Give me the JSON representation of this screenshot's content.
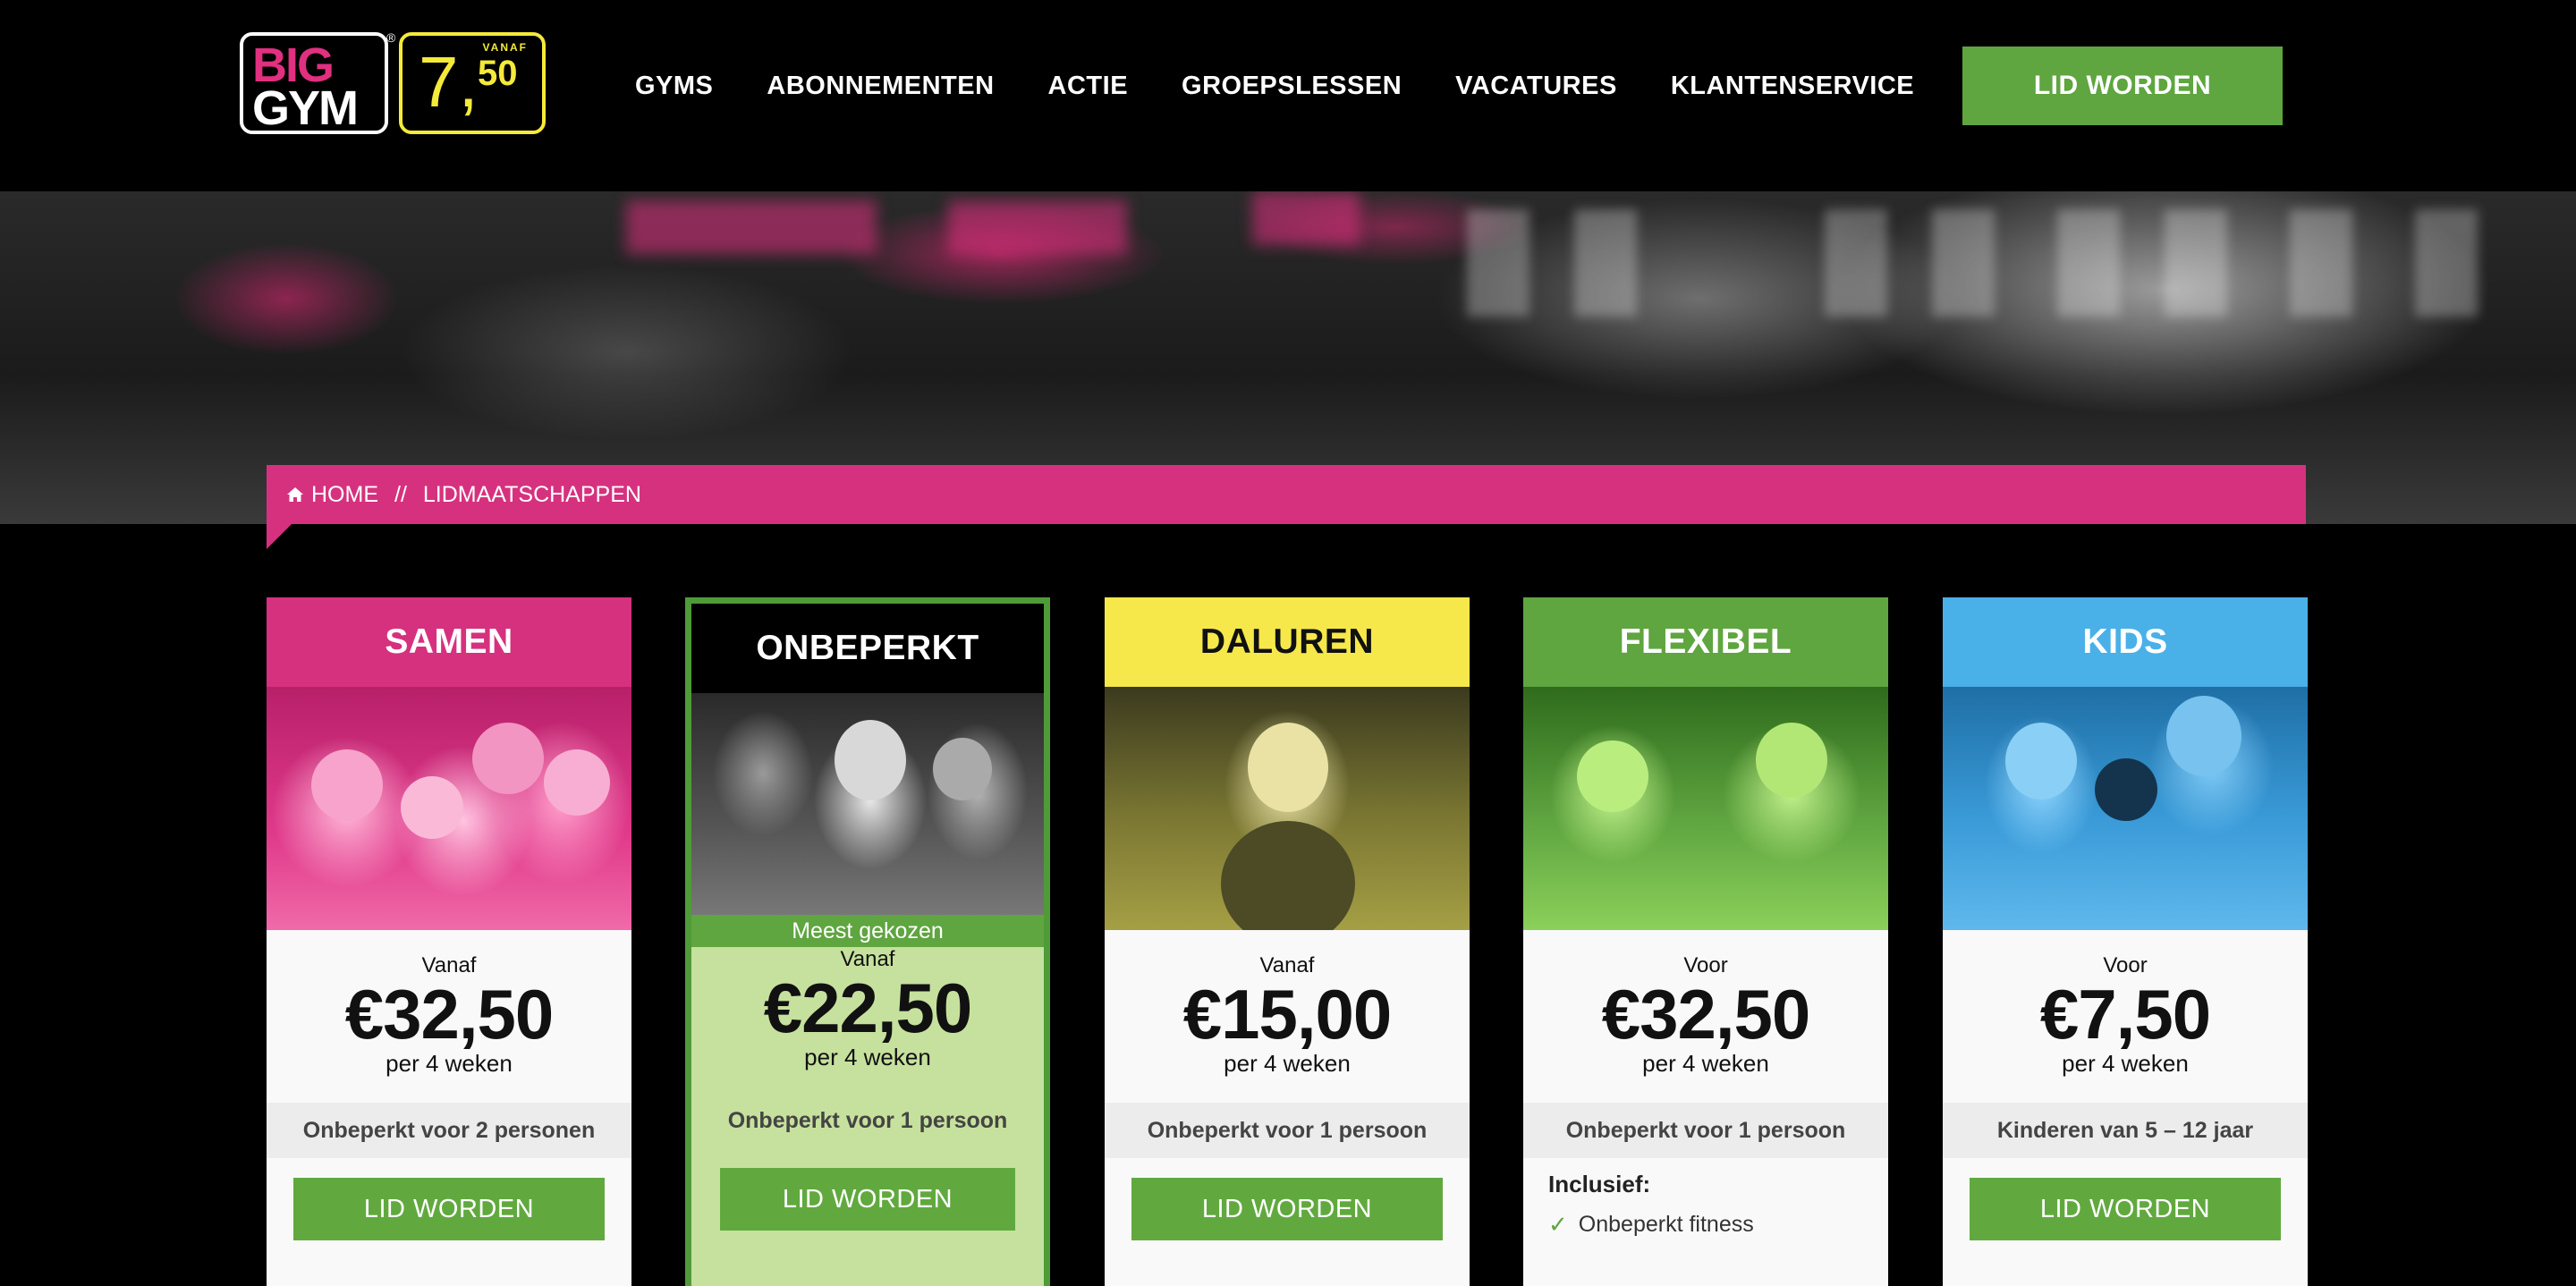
{
  "brand": {
    "logo_big": "BIG",
    "logo_gym": "GYM",
    "logo_registered": "®",
    "logo_vanaf": "VANAF",
    "logo_price_whole": "7,",
    "logo_price_cents": "50",
    "colors": {
      "pink": "#d6317f",
      "green": "#5fa540",
      "yellow": "#f4ea3a",
      "blue": "#4ab0e8"
    }
  },
  "nav": {
    "items": [
      "GYMS",
      "ABONNEMENTEN",
      "ACTIE",
      "GROEPSLESSEN",
      "VACATURES",
      "KLANTENSERVICE"
    ],
    "cta": "LID WORDEN"
  },
  "breadcrumb": {
    "home": "HOME",
    "separator": "//",
    "current": "LIDMAATSCHAPPEN",
    "icon": "home-icon"
  },
  "cards": [
    {
      "title": "SAMEN",
      "color": "#d6317f",
      "title_color": "#ffffff",
      "pre": "Vanaf",
      "price": "€32,50",
      "period": "per 4 weken",
      "feature": "Onbeperkt voor 2 personen",
      "cta": "LID WORDEN"
    },
    {
      "title": "ONBEPERKT",
      "color": "#000000",
      "title_color": "#ffffff",
      "badge": "Meest gekozen",
      "pre": "Vanaf",
      "price": "€22,50",
      "period": "per 4 weken",
      "feature": "Onbeperkt voor 1 persoon",
      "cta": "LID WORDEN"
    },
    {
      "title": "DALUREN",
      "color": "#f6e84a",
      "title_color": "#111111",
      "pre": "Vanaf",
      "price": "€15,00",
      "period": "per 4 weken",
      "feature": "Onbeperkt voor 1 persoon",
      "cta": "LID WORDEN"
    },
    {
      "title": "FLEXIBEL",
      "color": "#5fa540",
      "title_color": "#ffffff",
      "pre": "Voor",
      "price": "€32,50",
      "period": "per 4 weken",
      "feature": "Onbeperkt voor 1 persoon",
      "includes_title": "Inclusief:",
      "includes": [
        "Onbeperkt fitness"
      ]
    },
    {
      "title": "KIDS",
      "color": "#4ab0e8",
      "title_color": "#ffffff",
      "pre": "Voor",
      "price": "€7,50",
      "period": "per 4 weken",
      "feature": "Kinderen van 5 – 12 jaar",
      "cta": "LID WORDEN"
    }
  ]
}
